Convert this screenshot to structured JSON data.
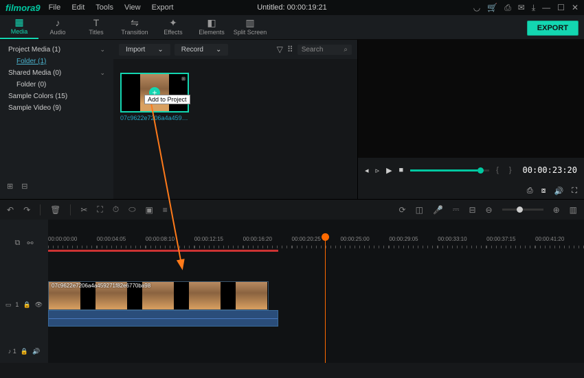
{
  "app": {
    "name": "filmora9",
    "title": "Untitled:  00:00:19:21"
  },
  "menu": [
    "File",
    "Edit",
    "Tools",
    "View",
    "Export"
  ],
  "tabs": [
    {
      "label": "Media",
      "icon": "▦"
    },
    {
      "label": "Audio",
      "icon": "♪"
    },
    {
      "label": "Titles",
      "icon": "T"
    },
    {
      "label": "Transition",
      "icon": "⇋"
    },
    {
      "label": "Effects",
      "icon": "✦"
    },
    {
      "label": "Elements",
      "icon": "◧"
    },
    {
      "label": "Split Screen",
      "icon": "▥"
    }
  ],
  "export_label": "EXPORT",
  "sidebar": {
    "items": [
      {
        "label": "Project Media (1)",
        "expand": true
      },
      {
        "label": "Folder (1)",
        "indent": true,
        "selected": true
      },
      {
        "label": "Shared Media (0)",
        "expand": true
      },
      {
        "label": "Folder (0)",
        "indent": true
      },
      {
        "label": "Sample Colors (15)"
      },
      {
        "label": "Sample Video (9)"
      }
    ]
  },
  "media_bar": {
    "import": "Import",
    "record": "Record",
    "search": "Search"
  },
  "thumb": {
    "caption": "07c9622e7206a4a4592...",
    "tooltip": "Add to Project"
  },
  "preview": {
    "time": "00:00:23:20"
  },
  "ruler": [
    "00:00:00:00",
    "00:00:04:05",
    "00:00:08:10",
    "00:00:12:15",
    "00:00:16:20",
    "00:00:20:25",
    "00:00:25:00",
    "00:00:29:05",
    "00:00:33:10",
    "00:00:37:15",
    "00:00:41:20"
  ],
  "clip": {
    "label": "07c9622e7206a4a459271f82e6770ba98"
  },
  "tracks": {
    "video": "1",
    "audio": "♪ 1"
  }
}
